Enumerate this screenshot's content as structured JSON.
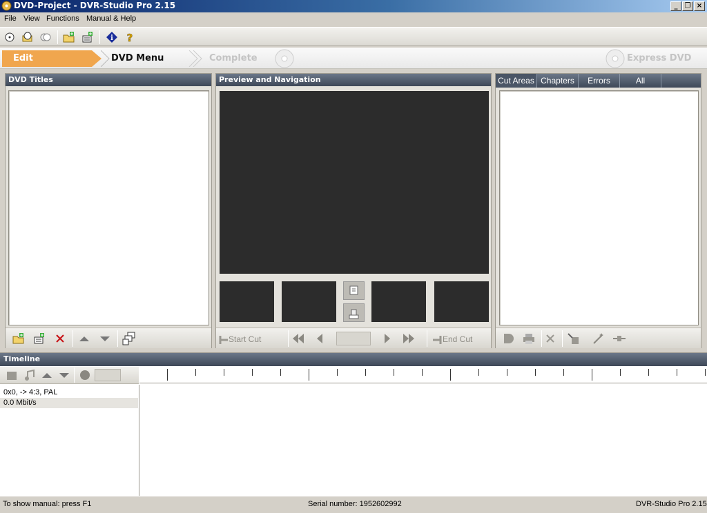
{
  "window": {
    "title": "DVD-Project - DVR-Studio Pro 2.15"
  },
  "menu": [
    "File",
    "View",
    "Functions",
    "Manual & Help"
  ],
  "steps": {
    "edit": "Edit",
    "dvd_menu": "DVD Menu",
    "complete": "Complete",
    "express": "Express DVD"
  },
  "titles_panel": {
    "title": "DVD Titles"
  },
  "preview_panel": {
    "title": "Preview and Navigation",
    "start_cut": "Start Cut",
    "end_cut": "End Cut",
    "position_value": ""
  },
  "right_panel": {
    "tabs": [
      "Cut Areas",
      "Chapters",
      "Errors",
      "All"
    ]
  },
  "timeline": {
    "title": "Timeline",
    "video_info": "0x0,  -> 4:3, PAL",
    "bitrate": "0.0 Mbit/s",
    "zoom_value": ""
  },
  "status": {
    "hint": "To show manual: press F1",
    "serial": "Serial number: 1952602992",
    "version": "DVR-Studio Pro 2.15"
  }
}
